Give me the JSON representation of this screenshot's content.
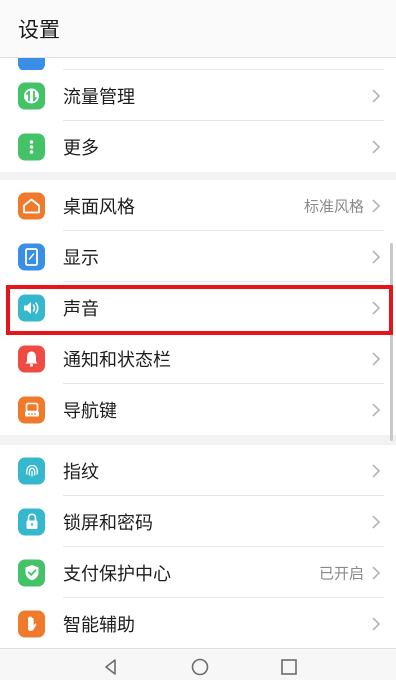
{
  "header": {
    "title": "设置"
  },
  "groups": [
    {
      "items": [
        {
          "label": "流量管理",
          "icon": "data-usage-icon",
          "color": "#43c267"
        },
        {
          "label": "更多",
          "icon": "more-dots-icon",
          "color": "#43c267"
        }
      ]
    },
    {
      "items": [
        {
          "label": "桌面风格",
          "value": "标准风格",
          "icon": "home-icon",
          "color": "#f07a2c"
        },
        {
          "label": "显示",
          "icon": "display-icon",
          "color": "#3a8ee6"
        },
        {
          "label": "声音",
          "icon": "speaker-icon",
          "color": "#35b7ce"
        },
        {
          "label": "通知和状态栏",
          "icon": "bell-icon",
          "color": "#ef4b43"
        },
        {
          "label": "导航键",
          "icon": "navigation-key-icon",
          "color": "#f07a2c"
        }
      ]
    },
    {
      "items": [
        {
          "label": "指纹",
          "icon": "fingerprint-icon",
          "color": "#35b7ce"
        },
        {
          "label": "锁屏和密码",
          "icon": "lock-icon",
          "color": "#35b7ce"
        },
        {
          "label": "支付保护中心",
          "value": "已开启",
          "icon": "shield-check-icon",
          "color": "#43c267"
        },
        {
          "label": "智能辅助",
          "icon": "hand-icon",
          "color": "#f07a2c"
        }
      ]
    }
  ],
  "colors": {
    "highlight": "#e8141b",
    "accent_green": "#43c267",
    "accent_orange": "#f07a2c",
    "accent_blue": "#3a8ee6",
    "accent_teal": "#35b7ce",
    "accent_red": "#ef4b43"
  }
}
